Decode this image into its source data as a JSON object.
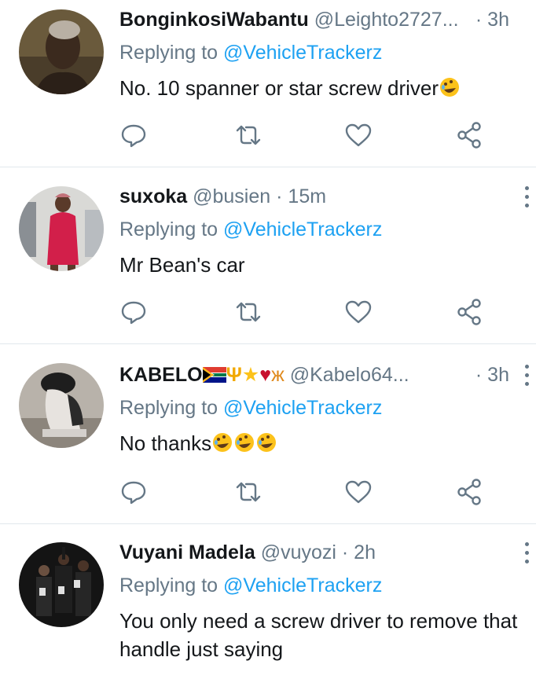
{
  "reply_label": "Replying to",
  "tweets": [
    {
      "name": "BonginkosiWabantu",
      "handle": "@Leighto2727...",
      "time": "· 3h",
      "mention": "@VehicleTrackerz",
      "text": "No. 10 spanner or star screw driver"
    },
    {
      "name": "suxoka",
      "handle": "@busien",
      "time": "· 15m",
      "mention": "@VehicleTrackerz",
      "text": "Mr Bean's car"
    },
    {
      "name": "KABELO",
      "handle": "@Kabelo64...",
      "time": "· 3h",
      "mention": "@VehicleTrackerz",
      "text": "No thanks"
    },
    {
      "name": "Vuyani Madela",
      "handle": "@vuyozi",
      "time": "· 2h",
      "mention": "@VehicleTrackerz",
      "text": "You only need a screw driver to remove that handle just saying"
    }
  ],
  "icons": {
    "reply": "reply-icon",
    "retweet": "retweet-icon",
    "like": "heart-icon",
    "share": "share-icon",
    "more": "more-icon",
    "laugh_emoji": "rolling-laughing-emoji",
    "flag": "south-africa-flag-emoji"
  },
  "colors": {
    "mention": "#1da1f2",
    "secondary_text": "#657786",
    "icon": "#657786",
    "divider": "#e1e8ed"
  }
}
